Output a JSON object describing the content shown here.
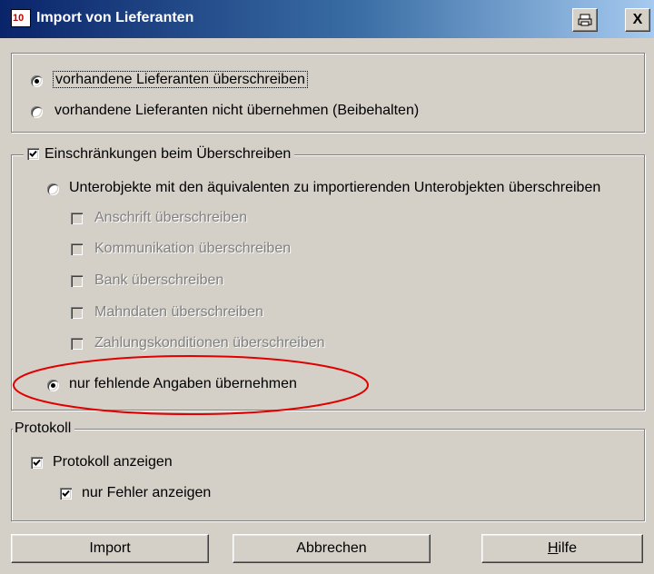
{
  "window": {
    "title": "Import von Lieferanten",
    "app_icon_text": "10",
    "print_button_icon": "print-icon",
    "close_button_label": "X"
  },
  "overwrite_group": {
    "options": [
      {
        "label": "vorhandene Lieferanten überschreiben",
        "selected": true
      },
      {
        "label": "vorhandene Lieferanten nicht übernehmen (Beibehalten)",
        "selected": false
      }
    ]
  },
  "restrictions_group": {
    "legend": "Einschränkungen beim Überschreiben",
    "enabled": true,
    "option_subobjects": {
      "label": "Unterobjekte mit den äquivalenten zu importierenden Unterobjekten überschreiben",
      "selected": false
    },
    "sub_checks": [
      {
        "label": "Anschrift überschreiben",
        "checked": false,
        "enabled": false
      },
      {
        "label": "Kommunikation überschreiben",
        "checked": false,
        "enabled": false
      },
      {
        "label": "Bank überschreiben",
        "checked": false,
        "enabled": false
      },
      {
        "label": "Mahndaten überschreiben",
        "checked": false,
        "enabled": false
      },
      {
        "label": "Zahlungskonditionen überschreiben",
        "checked": false,
        "enabled": false
      }
    ],
    "option_missing_only": {
      "label": "nur fehlende Angaben übernehmen",
      "selected": true
    }
  },
  "protocol_group": {
    "legend": "Protokoll",
    "show_protocol": {
      "label": "Protokoll anzeigen",
      "checked": true
    },
    "errors_only": {
      "label": "nur Fehler anzeigen",
      "checked": true
    }
  },
  "buttons": {
    "import": "Import",
    "cancel": "Abbrechen",
    "help_mnemonic": "H",
    "help_rest": "ilfe"
  },
  "colors": {
    "dialog_bg": "#d4d0c8",
    "title_gradient_start": "#0a246a",
    "title_gradient_end": "#a6caf0",
    "annotation_ellipse": "#e00000"
  }
}
